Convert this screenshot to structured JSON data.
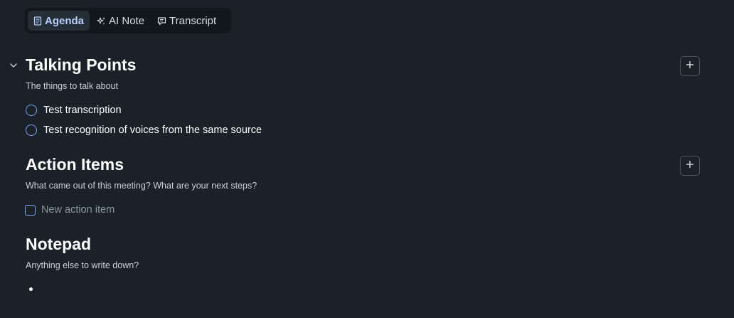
{
  "tabs": [
    {
      "label": "Agenda",
      "icon": "document-icon",
      "active": true
    },
    {
      "label": "AI Note",
      "icon": "sparkle-icon",
      "active": false
    },
    {
      "label": "Transcript",
      "icon": "chat-bubble-icon",
      "active": false
    }
  ],
  "talking_points": {
    "title": "Talking Points",
    "subtitle": "The things to talk about",
    "items": [
      {
        "text": "Test transcription"
      },
      {
        "text": "Test recognition of voices from the same source"
      }
    ]
  },
  "action_items": {
    "title": "Action Items",
    "subtitle": "What came out of this meeting? What are your next steps?",
    "new_placeholder": "New action item"
  },
  "notepad": {
    "title": "Notepad",
    "subtitle": "Anything else to write down?"
  },
  "colors": {
    "background": "#1a2128",
    "accent": "#7fa3f3",
    "active_tab_text": "#b9cdfb"
  }
}
